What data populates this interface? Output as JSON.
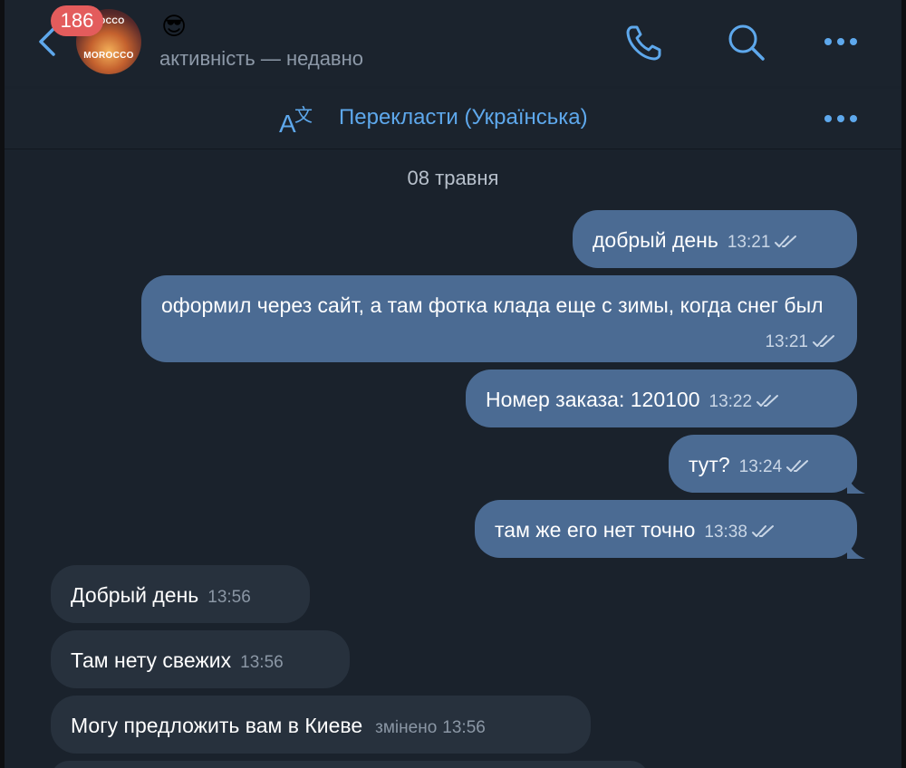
{
  "header": {
    "badge_count": "186",
    "avatar_text_top": "ROCCO",
    "avatar_text_mid": "MOROCCO",
    "emoji": "😎",
    "status": "активність — недавно"
  },
  "translate_bar": {
    "label": "Перекласти (Українська)"
  },
  "date_separator": "08 травня",
  "messages": [
    {
      "text": "добрый день",
      "time": "13:21",
      "direction": "out"
    },
    {
      "text": "оформил через сайт, а там фотка клада еще с зимы, когда снег был",
      "time": "13:21",
      "direction": "out"
    },
    {
      "text": "Номер заказа: 120100",
      "time": "13:22",
      "direction": "out"
    },
    {
      "text": "тут?",
      "time": "13:24",
      "direction": "out"
    },
    {
      "text": "там же его нет точно",
      "time": "13:38",
      "direction": "out"
    },
    {
      "text": "Добрый день",
      "time": "13:56",
      "direction": "in"
    },
    {
      "text": "Там нету свежих",
      "time": "13:56",
      "direction": "in"
    },
    {
      "text": "Могу предложить вам в Киеве",
      "time": "13:56",
      "edited": "змінено",
      "direction": "in"
    }
  ],
  "colors": {
    "accent": "#5ea8ec",
    "outgoing_bubble": "#4b6b93",
    "incoming_bubble": "#27313d",
    "badge": "#e35c5c"
  }
}
